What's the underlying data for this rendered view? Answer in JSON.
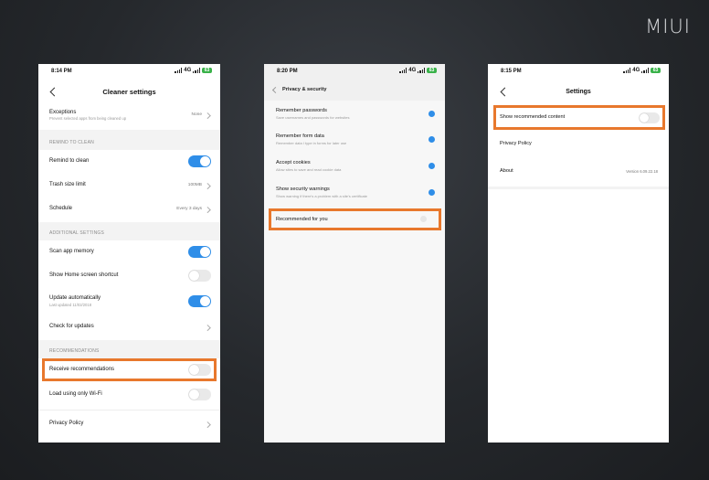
{
  "brand": "MIUI",
  "colors": {
    "accent": "#2f8ee8",
    "highlight": "#e8782d",
    "toggle_off": "#e9e9e9",
    "battery": "#3ab24a"
  },
  "phone1": {
    "status": {
      "time": "8:14 PM",
      "network": "4G",
      "battery": "63"
    },
    "title": "Cleaner settings",
    "exceptions": {
      "label": "Exceptions",
      "sub": "Prevent selected apps from being cleaned up",
      "value": "None"
    },
    "section_remind": "REMIND TO CLEAN",
    "remind": {
      "label": "Remind to clean",
      "on": true
    },
    "trash": {
      "label": "Trash size limit",
      "value": "100MB"
    },
    "schedule": {
      "label": "Schedule",
      "value": "Every 3 days"
    },
    "section_additional": "ADDITIONAL SETTINGS",
    "scan": {
      "label": "Scan app memory",
      "on": true
    },
    "shortcut": {
      "label": "Show Home screen shortcut",
      "on": false
    },
    "update": {
      "label": "Update automatically",
      "sub": "Last updated 11/02/2018",
      "on": true
    },
    "check": {
      "label": "Check for updates"
    },
    "section_recommend": "RECOMMENDATIONS",
    "receive": {
      "label": "Receive recommendations",
      "on": false
    },
    "wifi": {
      "label": "Load using only Wi-Fi",
      "on": false
    },
    "privacy": {
      "label": "Privacy Policy"
    }
  },
  "phone2": {
    "status": {
      "time": "8:20 PM",
      "network": "4G",
      "battery": "63"
    },
    "title": "Privacy & security",
    "items": [
      {
        "label": "Remember passwords",
        "sub": "Save usernames and passwords for websites",
        "on": true
      },
      {
        "label": "Remember form data",
        "sub": "Remember data I type in forms for later use",
        "on": true
      },
      {
        "label": "Accept cookies",
        "sub": "Allow sites to save and read cookie data",
        "on": true
      },
      {
        "label": "Show security warnings",
        "sub": "Show warning if there's a problem with a site's certificate",
        "on": true
      }
    ],
    "recommended": {
      "label": "Recommended for you",
      "on": false
    }
  },
  "phone3": {
    "status": {
      "time": "8:15 PM",
      "network": "4G",
      "battery": "63"
    },
    "title": "Settings",
    "show_rec": {
      "label": "Show recommended content",
      "on": false
    },
    "privacy": {
      "label": "Privacy Policy"
    },
    "about": {
      "label": "About",
      "value": "Version 6.09.22.18"
    }
  }
}
